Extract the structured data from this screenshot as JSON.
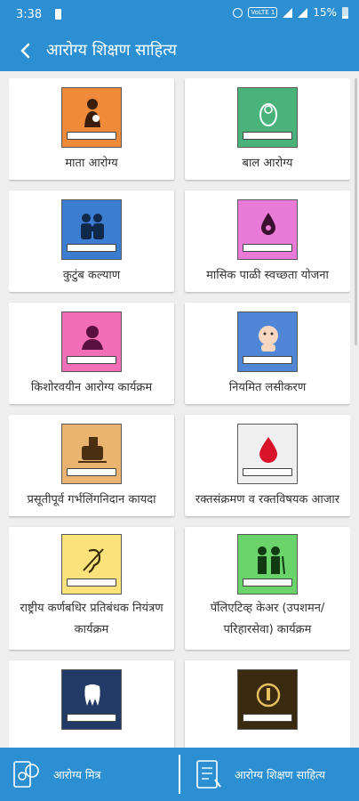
{
  "status_bar": {
    "time": "3:38",
    "network": "VoLTE 1",
    "battery": "15%"
  },
  "app_bar": {
    "title": "आरोग्य शिक्षण साहित्य"
  },
  "cards": [
    {
      "label": "माता आरोग्य",
      "color": "#ef8a3a",
      "icon": "mother-baby-icon"
    },
    {
      "label": "बाल आरोग्य",
      "color": "#49b37a",
      "icon": "infant-icon"
    },
    {
      "label": "कुटुंब कल्याण",
      "color": "#3b7dd0",
      "icon": "family-icon"
    },
    {
      "label": "मासिक पाळी स्वच्छता योजना",
      "color": "#ea7ad8",
      "icon": "blood-drop-icon"
    },
    {
      "label": "किशोरवयीन आरोग्य कार्यक्रम",
      "color": "#f26fb8",
      "icon": "teen-icon"
    },
    {
      "label": "नियमित लसीकरण",
      "color": "#4f87d6",
      "icon": "vaccination-baby-icon"
    },
    {
      "label": "प्रसूतीपूर्व गर्भलिंगनिदान कायदा",
      "color": "#eab370",
      "icon": "ultrasound-icon"
    },
    {
      "label": "रक्तसंक्रमण व रक्तविषयक आजार",
      "color": "#f0f0f0",
      "icon": "blood-drop-red-icon"
    },
    {
      "label": "राष्ट्रीय कर्णबधिर प्रतिबंधक नियंत्रण कार्यक्रम",
      "color": "#fbe27a",
      "icon": "deaf-ear-icon"
    },
    {
      "label": "पॅलिएटिव्ह केअर (उपशमन/ परिहारसेवा) कार्यक्रम",
      "color": "#6ad36a",
      "icon": "caregiver-icon"
    },
    {
      "label": "",
      "color": "#223a66",
      "icon": "tooth-icon"
    },
    {
      "label": "",
      "color": "#3a2a10",
      "icon": "emblem-icon"
    }
  ],
  "bottom_nav": {
    "items": [
      {
        "label": "आरोग्य मित्र"
      },
      {
        "label": "आरोग्य शिक्षण साहित्य"
      }
    ]
  }
}
